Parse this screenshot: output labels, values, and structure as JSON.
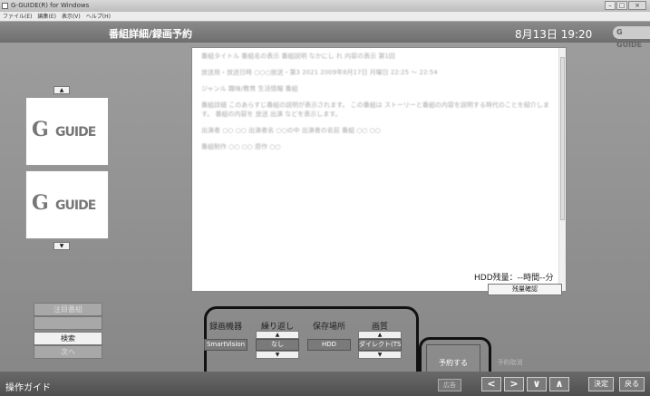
{
  "window": {
    "title": "G-GUIDE(R) for Windows"
  },
  "menu": [
    "ファイル(E)",
    "編集(E)",
    "表示(V)",
    "ヘルプ(H)"
  ],
  "header": {
    "title": "番組詳細/録画予約",
    "datetime": "8月13日 19:20",
    "logo": "G GUIDE"
  },
  "left": {
    "logo_text": "GUIDE",
    "buttons": {
      "featured": "注目番組",
      "search": "検索",
      "next": "次へ"
    }
  },
  "detail": {
    "paragraphs": [
      "番組タイトル 番組名の表示 番組説明 なかにし れ 内容の表示 第1回",
      "放送局・放送日時 ○○○放送・第3 2021 2009年8月17日 月曜日 22:25 ～ 22:54",
      "ジャンル 趣味/教育 生活情報 番組",
      "番組詳細 このあらすじ番組の説明が表示されます。 この番組は ストーリーと番組の内容を説明する時代のことを紹介します。 番組の内容を 放送 出演 などを表示します。",
      "出演者 ○○ ○○ 出演者名 ○○の中 出演者の名前 番組 ○○ ○○",
      "番組制作 ○○ ○○ 原作 ○○"
    ]
  },
  "hdd": {
    "remaining": "HDD残量：--時間--分",
    "check_button": "残量確認"
  },
  "recording": {
    "columns": [
      {
        "header": "録画機器",
        "value": "SmartVision"
      },
      {
        "header": "繰り返し",
        "value": "なし"
      },
      {
        "header": "保存場所",
        "value": "HDD"
      },
      {
        "header": "画質",
        "value": "ダイレクト(TS)"
      }
    ],
    "reserve_button": "予約する",
    "cancel_button": "予約取消"
  },
  "footer": {
    "guide": "操作ガイド",
    "ad": "広告",
    "enter": "決定",
    "back": "戻る"
  }
}
